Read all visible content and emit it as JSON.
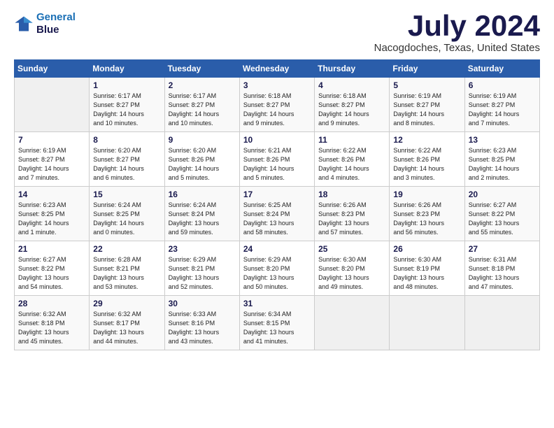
{
  "header": {
    "logo_line1": "General",
    "logo_line2": "Blue",
    "month_title": "July 2024",
    "location": "Nacogdoches, Texas, United States"
  },
  "days_of_week": [
    "Sunday",
    "Monday",
    "Tuesday",
    "Wednesday",
    "Thursday",
    "Friday",
    "Saturday"
  ],
  "weeks": [
    [
      {
        "day": "",
        "info": ""
      },
      {
        "day": "1",
        "info": "Sunrise: 6:17 AM\nSunset: 8:27 PM\nDaylight: 14 hours\nand 10 minutes."
      },
      {
        "day": "2",
        "info": "Sunrise: 6:17 AM\nSunset: 8:27 PM\nDaylight: 14 hours\nand 10 minutes."
      },
      {
        "day": "3",
        "info": "Sunrise: 6:18 AM\nSunset: 8:27 PM\nDaylight: 14 hours\nand 9 minutes."
      },
      {
        "day": "4",
        "info": "Sunrise: 6:18 AM\nSunset: 8:27 PM\nDaylight: 14 hours\nand 9 minutes."
      },
      {
        "day": "5",
        "info": "Sunrise: 6:19 AM\nSunset: 8:27 PM\nDaylight: 14 hours\nand 8 minutes."
      },
      {
        "day": "6",
        "info": "Sunrise: 6:19 AM\nSunset: 8:27 PM\nDaylight: 14 hours\nand 7 minutes."
      }
    ],
    [
      {
        "day": "7",
        "info": "Sunrise: 6:19 AM\nSunset: 8:27 PM\nDaylight: 14 hours\nand 7 minutes."
      },
      {
        "day": "8",
        "info": "Sunrise: 6:20 AM\nSunset: 8:27 PM\nDaylight: 14 hours\nand 6 minutes."
      },
      {
        "day": "9",
        "info": "Sunrise: 6:20 AM\nSunset: 8:26 PM\nDaylight: 14 hours\nand 5 minutes."
      },
      {
        "day": "10",
        "info": "Sunrise: 6:21 AM\nSunset: 8:26 PM\nDaylight: 14 hours\nand 5 minutes."
      },
      {
        "day": "11",
        "info": "Sunrise: 6:22 AM\nSunset: 8:26 PM\nDaylight: 14 hours\nand 4 minutes."
      },
      {
        "day": "12",
        "info": "Sunrise: 6:22 AM\nSunset: 8:26 PM\nDaylight: 14 hours\nand 3 minutes."
      },
      {
        "day": "13",
        "info": "Sunrise: 6:23 AM\nSunset: 8:25 PM\nDaylight: 14 hours\nand 2 minutes."
      }
    ],
    [
      {
        "day": "14",
        "info": "Sunrise: 6:23 AM\nSunset: 8:25 PM\nDaylight: 14 hours\nand 1 minute."
      },
      {
        "day": "15",
        "info": "Sunrise: 6:24 AM\nSunset: 8:25 PM\nDaylight: 14 hours\nand 0 minutes."
      },
      {
        "day": "16",
        "info": "Sunrise: 6:24 AM\nSunset: 8:24 PM\nDaylight: 13 hours\nand 59 minutes."
      },
      {
        "day": "17",
        "info": "Sunrise: 6:25 AM\nSunset: 8:24 PM\nDaylight: 13 hours\nand 58 minutes."
      },
      {
        "day": "18",
        "info": "Sunrise: 6:26 AM\nSunset: 8:23 PM\nDaylight: 13 hours\nand 57 minutes."
      },
      {
        "day": "19",
        "info": "Sunrise: 6:26 AM\nSunset: 8:23 PM\nDaylight: 13 hours\nand 56 minutes."
      },
      {
        "day": "20",
        "info": "Sunrise: 6:27 AM\nSunset: 8:22 PM\nDaylight: 13 hours\nand 55 minutes."
      }
    ],
    [
      {
        "day": "21",
        "info": "Sunrise: 6:27 AM\nSunset: 8:22 PM\nDaylight: 13 hours\nand 54 minutes."
      },
      {
        "day": "22",
        "info": "Sunrise: 6:28 AM\nSunset: 8:21 PM\nDaylight: 13 hours\nand 53 minutes."
      },
      {
        "day": "23",
        "info": "Sunrise: 6:29 AM\nSunset: 8:21 PM\nDaylight: 13 hours\nand 52 minutes."
      },
      {
        "day": "24",
        "info": "Sunrise: 6:29 AM\nSunset: 8:20 PM\nDaylight: 13 hours\nand 50 minutes."
      },
      {
        "day": "25",
        "info": "Sunrise: 6:30 AM\nSunset: 8:20 PM\nDaylight: 13 hours\nand 49 minutes."
      },
      {
        "day": "26",
        "info": "Sunrise: 6:30 AM\nSunset: 8:19 PM\nDaylight: 13 hours\nand 48 minutes."
      },
      {
        "day": "27",
        "info": "Sunrise: 6:31 AM\nSunset: 8:18 PM\nDaylight: 13 hours\nand 47 minutes."
      }
    ],
    [
      {
        "day": "28",
        "info": "Sunrise: 6:32 AM\nSunset: 8:18 PM\nDaylight: 13 hours\nand 45 minutes."
      },
      {
        "day": "29",
        "info": "Sunrise: 6:32 AM\nSunset: 8:17 PM\nDaylight: 13 hours\nand 44 minutes."
      },
      {
        "day": "30",
        "info": "Sunrise: 6:33 AM\nSunset: 8:16 PM\nDaylight: 13 hours\nand 43 minutes."
      },
      {
        "day": "31",
        "info": "Sunrise: 6:34 AM\nSunset: 8:15 PM\nDaylight: 13 hours\nand 41 minutes."
      },
      {
        "day": "",
        "info": ""
      },
      {
        "day": "",
        "info": ""
      },
      {
        "day": "",
        "info": ""
      }
    ]
  ]
}
